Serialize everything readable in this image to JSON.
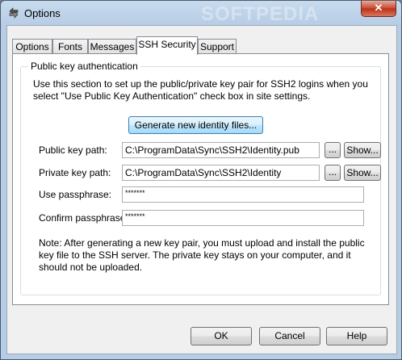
{
  "window": {
    "title": "Options",
    "watermark": "SOFTPEDIA",
    "close_glyph": "✕"
  },
  "tabs": [
    {
      "label": "Options"
    },
    {
      "label": "Fonts"
    },
    {
      "label": "Messages"
    },
    {
      "label": "SSH Security",
      "active": true
    },
    {
      "label": "Support"
    }
  ],
  "group": {
    "title": "Public key authentication",
    "description": "Use this section to set up the public/private key pair for SSH2 logins when you select \"Use Public Key Authentication\" check box in site settings.",
    "generate_label": "Generate new identity files...",
    "public_key": {
      "label": "Public key path:",
      "value": "C:\\ProgramData\\Sync\\SSH2\\Identity.pub",
      "browse": "...",
      "show": "Show..."
    },
    "private_key": {
      "label": "Private key path:",
      "value": "C:\\ProgramData\\Sync\\SSH2\\Identity",
      "browse": "...",
      "show": "Show..."
    },
    "passphrase": {
      "label": "Use passphrase:",
      "value": "*******"
    },
    "confirm": {
      "label": "Confirm passphrase:",
      "value": "*******"
    },
    "note": "Note: After generating a new key pair, you must upload and install the public key file to the SSH server. The private key stays on your computer, and it should not be uploaded."
  },
  "footer": {
    "ok": "OK",
    "cancel": "Cancel",
    "help": "Help"
  }
}
